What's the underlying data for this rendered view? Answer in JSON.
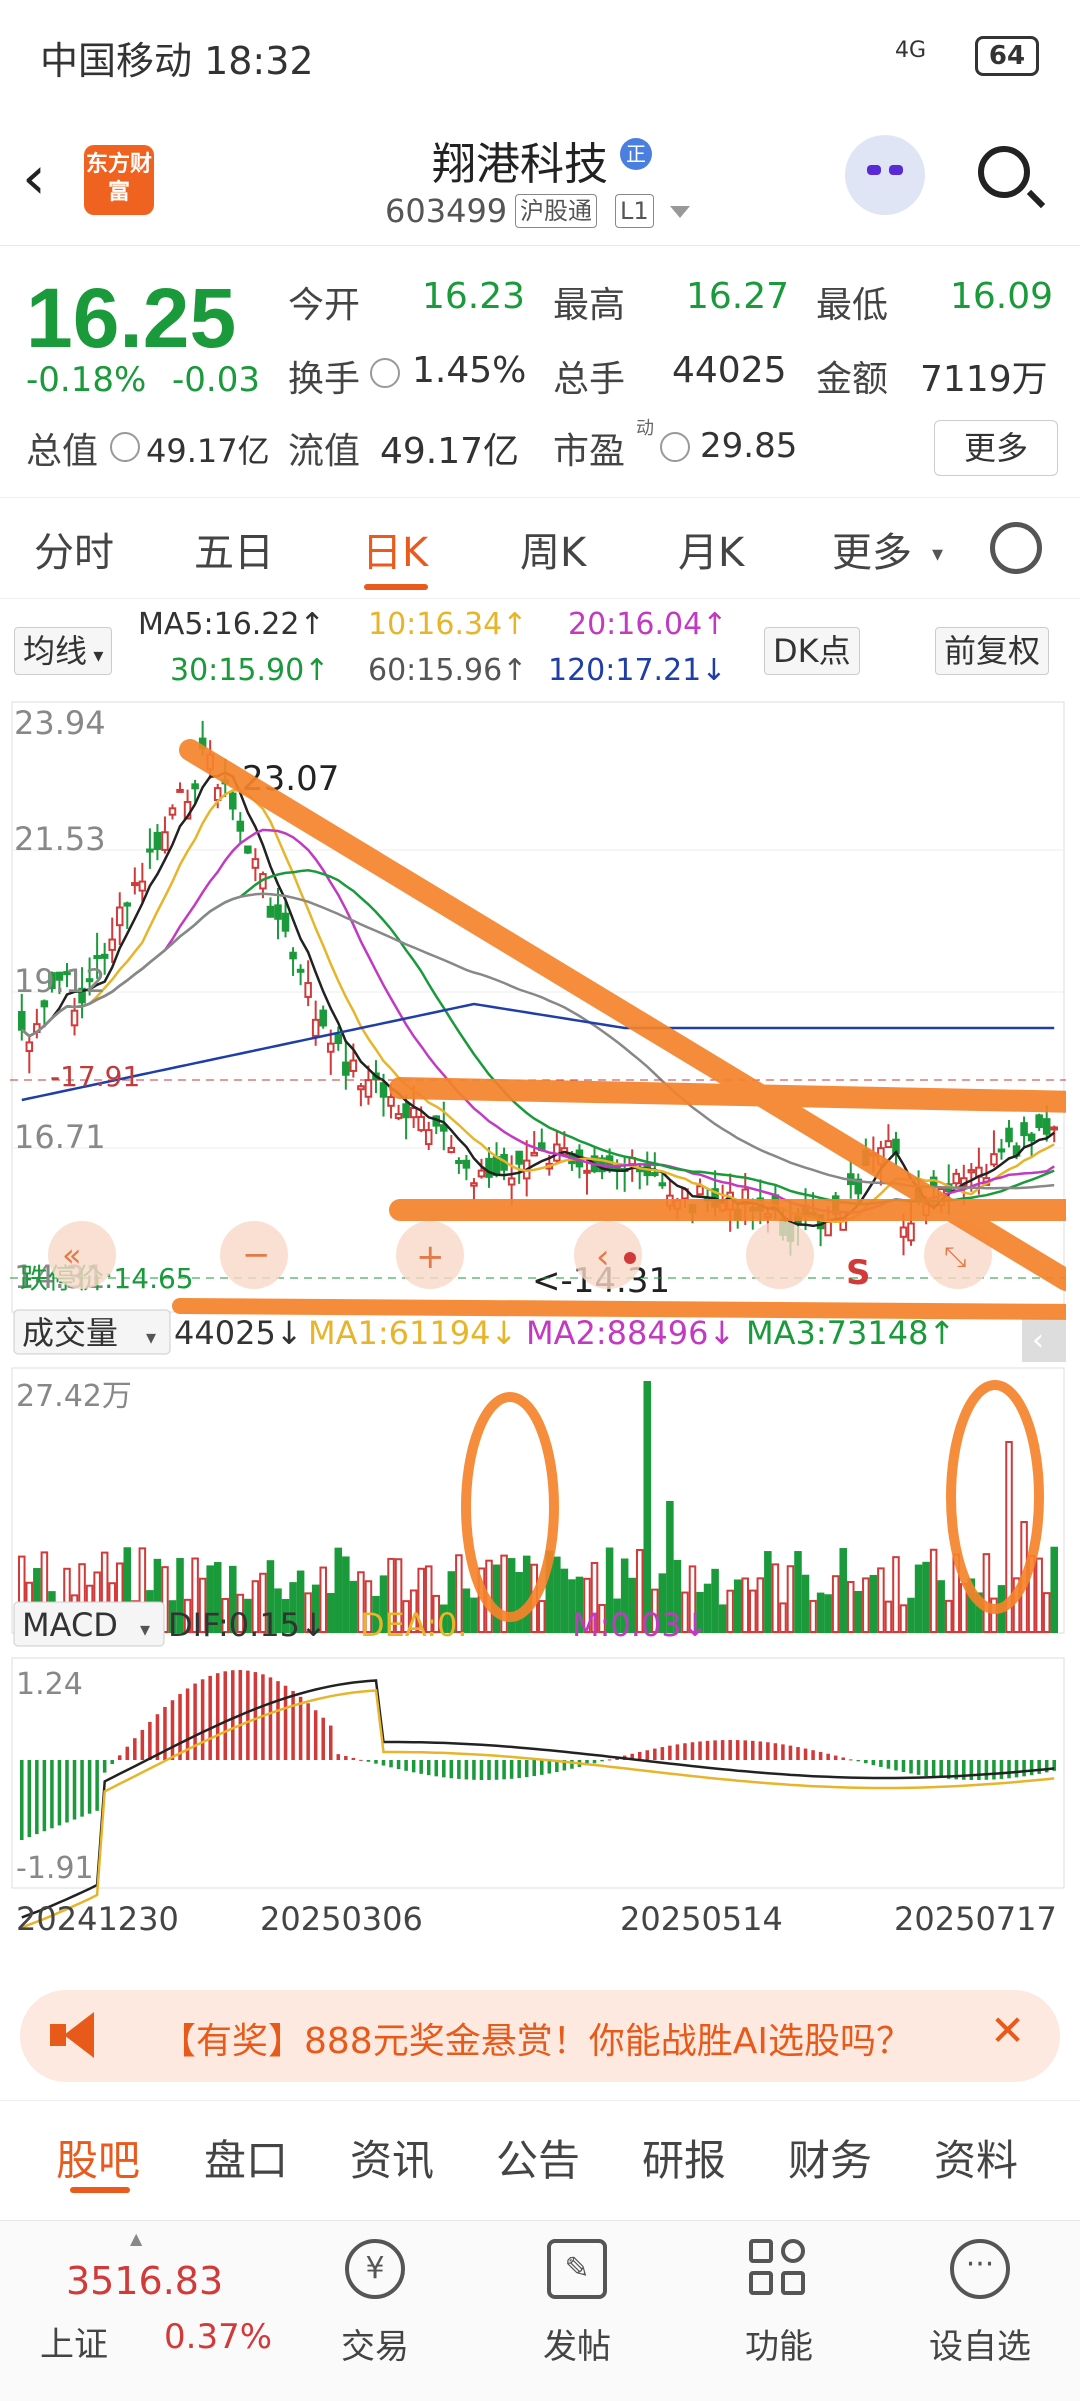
{
  "status_bar": {
    "carrier_time": "中国移动 18:32",
    "signal": "4G",
    "battery": "64"
  },
  "header": {
    "logo_text": "东方财富",
    "stock_name": "翔港科技",
    "verified_badge": "正",
    "code": "603499",
    "tag1": "沪股通",
    "tag2": "L1"
  },
  "quote": {
    "price": "16.25",
    "change_pct": "-0.18%",
    "change": "-0.03",
    "fields": [
      {
        "label": "今开",
        "value": "16.23"
      },
      {
        "label": "最高",
        "value": "16.27"
      },
      {
        "label": "最低",
        "value": "16.09"
      },
      {
        "label": "换手",
        "value": "1.45%"
      },
      {
        "label": "总手",
        "value": "44025"
      },
      {
        "label": "金额",
        "value": "7119万"
      },
      {
        "label": "总值",
        "value": "49.17亿"
      },
      {
        "label": "流值",
        "value": "49.17亿"
      },
      {
        "label": "市盈",
        "value": "29.85"
      }
    ],
    "pe_superscript": "动",
    "more": "更多"
  },
  "tabs": [
    "分时",
    "五日",
    "日K",
    "周K",
    "月K",
    "更多"
  ],
  "ma_bar": {
    "mode": "均线",
    "ma5": "MA5:16.22↑",
    "ma10": "10:16.34↑",
    "ma20": "20:16.04↑",
    "ma30": "30:15.90↑",
    "ma60": "60:15.96↑",
    "ma120": "120:17.21↓",
    "dk": "DK点",
    "adjust": "前复权"
  },
  "chart_labels": {
    "y_top": "23.94",
    "y_2": "21.53",
    "y_3": "19.12",
    "y_4": "16.71",
    "y_5": "14.31",
    "high_mark": "23.07",
    "low_mark": "<-14.31",
    "ref_price": "-17.91",
    "stop_price": "跌停价:14.65",
    "vol_label": "成交量",
    "vol_value": "44025↓",
    "vol_ma1": "MA1:61194↓",
    "vol_ma2": "MA2:88496↓",
    "vol_ma3": "MA3:73148↑",
    "vol_max": "27.42万",
    "macd_label": "MACD",
    "dif": "DIF:0.15↓",
    "dea": "DEA:0.",
    "m": "M:0.03↓",
    "macd_top": "1.24",
    "macd_bot": "-1.91",
    "dates": [
      "20241230",
      "20250306",
      "20250514",
      "20250717"
    ],
    "s_mark": "S"
  },
  "colors": {
    "up": "#d23a3a",
    "down": "#1a9a3a",
    "accent": "#ea5a1d",
    "annotation": "#f5832b"
  },
  "banner": {
    "text": "【有奖】888元奖金悬赏！你能战胜AI选股吗？"
  },
  "bottom_tabs": [
    "股吧",
    "盘口",
    "资讯",
    "公告",
    "研报",
    "财务",
    "资料"
  ],
  "nav": {
    "index_name": "上证",
    "index_value": "3516.83",
    "index_change": "0.37%",
    "items": [
      "交易",
      "发帖",
      "功能",
      "设自选"
    ]
  }
}
